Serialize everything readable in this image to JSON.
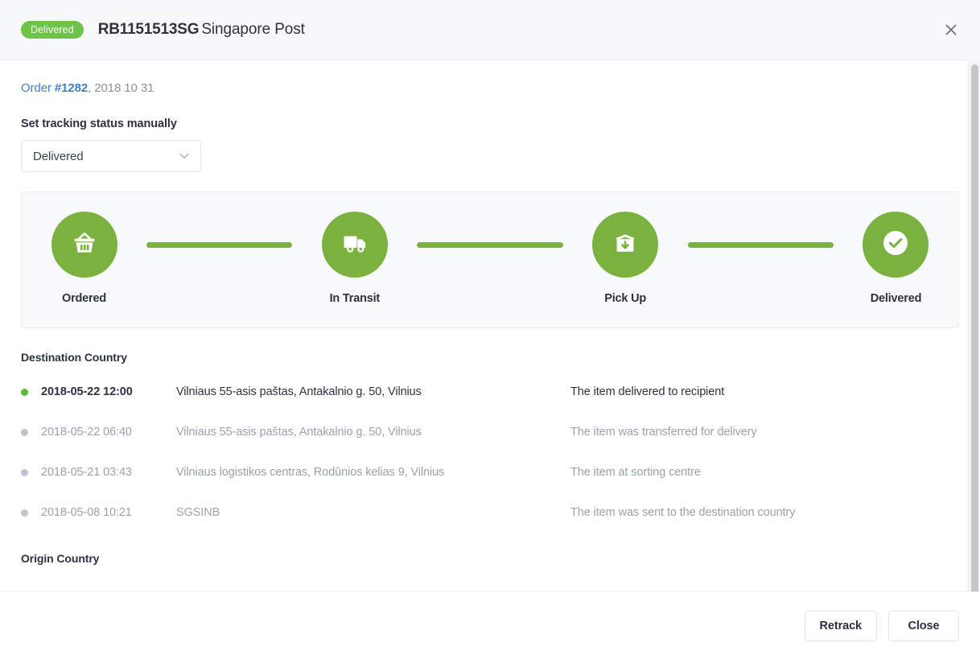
{
  "header": {
    "status_badge": "Delivered",
    "tracking_number": "RB1151513SG",
    "carrier_name": "Singapore Post",
    "close_icon": "close-icon"
  },
  "order": {
    "link_prefix": "Order ",
    "number": "#1282",
    "date": ", 2018 10 31"
  },
  "status_field": {
    "label": "Set tracking status manually",
    "selected_value": "Delivered",
    "chevron_icon": "chevron-down-icon"
  },
  "progress": {
    "steps": [
      {
        "label": "Ordered",
        "icon": "shopping-basket-icon",
        "done": true
      },
      {
        "label": "In Transit",
        "icon": "delivery-truck-icon",
        "done": true
      },
      {
        "label": "Pick Up",
        "icon": "box-download-icon",
        "done": true
      },
      {
        "label": "Delivered",
        "icon": "check-circle-icon",
        "done": true
      }
    ],
    "active_color": "#7ab13f"
  },
  "destination": {
    "title": "Destination Country",
    "rows": [
      {
        "time": "2018-05-22 12:00",
        "place": "Vilniaus 55-asis paštas, Antakalnio g. 50, Vilnius",
        "description": "The item delivered to recipient",
        "current": true
      },
      {
        "time": "2018-05-22 06:40",
        "place": "Vilniaus 55-asis paštas, Antakalnio g. 50, Vilnius",
        "description": "The item was transferred for delivery",
        "current": false
      },
      {
        "time": "2018-05-21 03:43",
        "place": "Vilniaus logistikos centras, Rodūnios kelias 9, Vilnius",
        "description": "The item at sorting centre",
        "current": false
      },
      {
        "time": "2018-05-08 10:21",
        "place": "SGSINB",
        "description": "The item was sent to the destination country",
        "current": false
      }
    ]
  },
  "origin": {
    "title": "Origin Country"
  },
  "footer": {
    "retrack_label": "Retrack",
    "close_label": "Close"
  },
  "colors": {
    "accent_green": "#7ab13f",
    "badge_green": "#6dc447",
    "link_blue": "#3d7fd0",
    "text_dark": "#2c3242",
    "text_muted": "#9aa2ae"
  }
}
